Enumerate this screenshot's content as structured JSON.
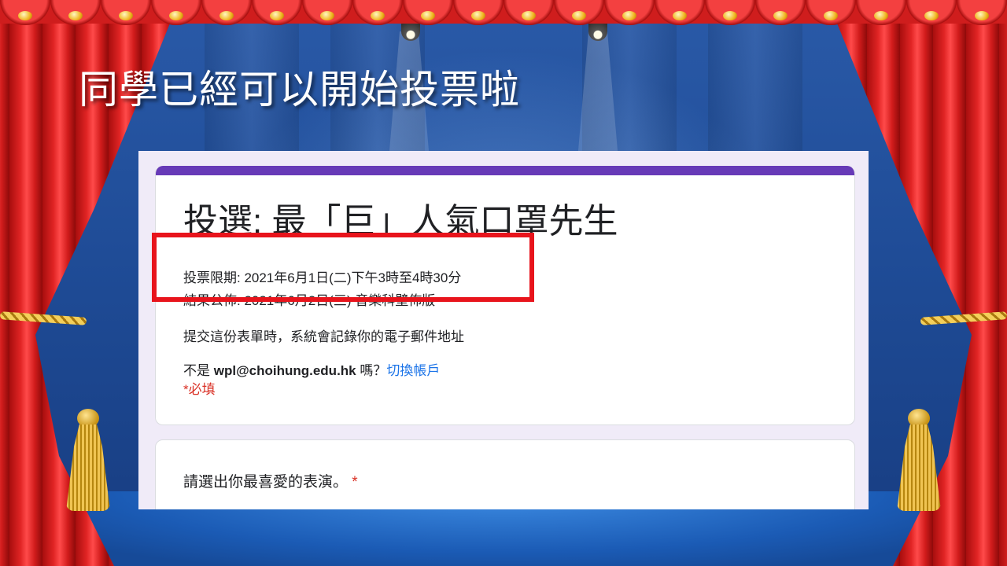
{
  "slide": {
    "title": "同學已經可以開始投票啦"
  },
  "form": {
    "title": "投選: 最「巨」人氣口罩先生",
    "description": {
      "line1": "投票限期: 2021年6月1日(二)下午3時至4時30分",
      "line2": "結果公佈: 2021年6月2日(三) 音樂科壁佈版"
    },
    "email_notice": "提交這份表單時，系統會記錄你的電子郵件地址",
    "account": {
      "prefix": "不是 ",
      "email": "wpl@choihung.edu.hk",
      "suffix": " 嗎？",
      "switch_label": "切換帳戶"
    },
    "required_note": "*必填",
    "question": {
      "text": "請選出你最喜愛的表演。",
      "required_mark": "*"
    }
  },
  "colors": {
    "form_accent": "#673ab7",
    "highlight": "#e8141c",
    "required": "#d93025",
    "link": "#1a73e8"
  }
}
